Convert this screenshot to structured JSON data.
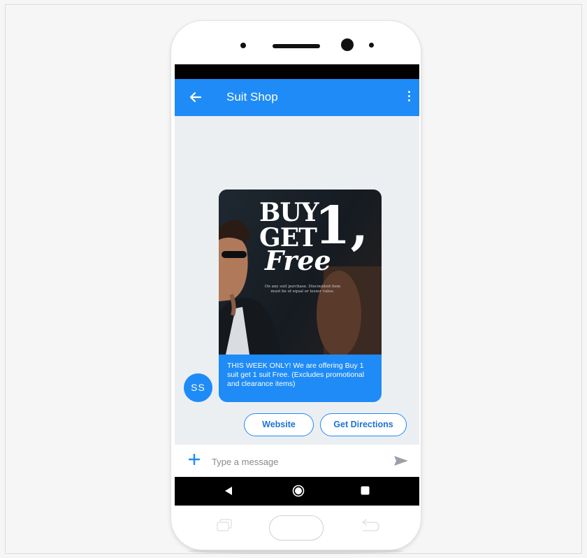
{
  "app_bar": {
    "title": "Suit Shop"
  },
  "promo_card": {
    "media": {
      "line_buy": "BUY",
      "line_get": "GET",
      "line_one": "1,",
      "line_free": "Free",
      "fine_print": "On any suit purchase. Discounted item must be of equal or lesser value."
    },
    "message": "THIS WEEK ONLY! We are offering Buy 1 suit get 1 suit Free. (Excludes promotional and clearance items)"
  },
  "sender": {
    "initials": "SS"
  },
  "suggestions": [
    {
      "label": "Website"
    },
    {
      "label": "Get Directions"
    }
  ],
  "compose": {
    "placeholder": "Type a message",
    "value": ""
  },
  "icons": {
    "back": "arrow-left-icon",
    "menu": "more-vertical-icon",
    "attach": "plus-icon",
    "send": "send-icon",
    "nav_back": "triangle-back-icon",
    "nav_home": "circle-home-icon",
    "nav_recent": "square-recent-icon"
  },
  "colors": {
    "accent": "#1e8bf7",
    "chat_background": "#eceff2",
    "chip_text": "#1e73d4"
  }
}
